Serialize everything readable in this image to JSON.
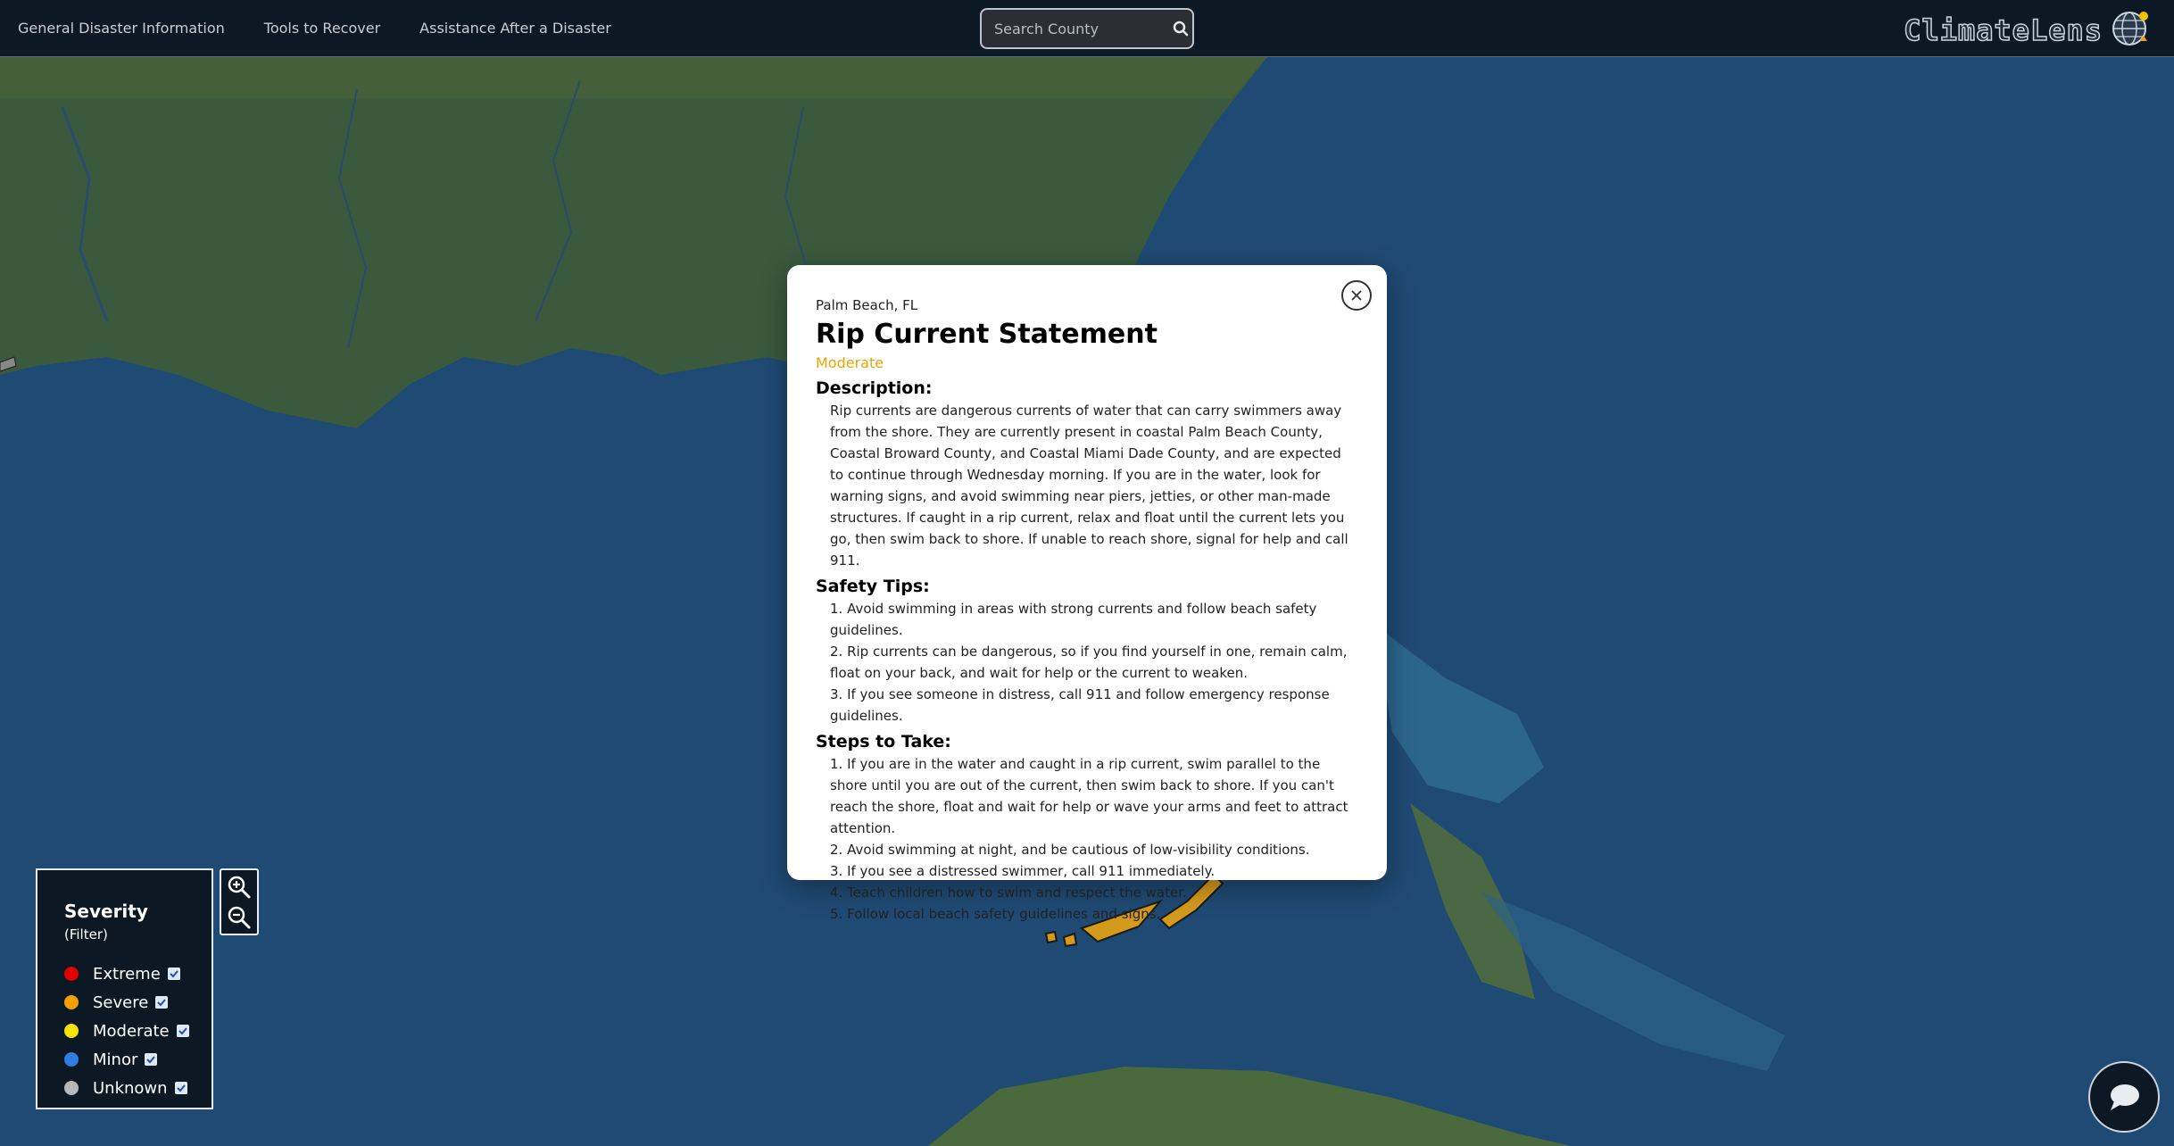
{
  "nav": {
    "links": [
      "General Disaster Information",
      "Tools to Recover",
      "Assistance After a Disaster"
    ]
  },
  "search": {
    "placeholder": "Search County",
    "value": ""
  },
  "brand": {
    "name": "ClimateLens"
  },
  "modal": {
    "location": "Palm Beach, FL",
    "title": "Rip Current Statement",
    "severity": "Moderate",
    "severity_color": "#e8a400",
    "description_label": "Description:",
    "description": "Rip currents are dangerous currents of water that can carry swimmers away from the shore. They are currently present in coastal Palm Beach County, Coastal Broward County, and Coastal Miami Dade County, and are expected to continue through Wednesday morning. If you are in the water, look for warning signs, and avoid swimming near piers, jetties, or other man-made structures. If caught in a rip current, relax and float until the current lets you go, then swim back to shore. If unable to reach shore, signal for help and call 911.",
    "tips_label": "Safety Tips:",
    "tips": [
      "1. Avoid swimming in areas with strong currents and follow beach safety guidelines.",
      "2. Rip currents can be dangerous, so if you find yourself in one, remain calm, float on your back, and wait for help or the current to weaken.",
      "3. If you see someone in distress, call 911 and follow emergency response guidelines."
    ],
    "steps_label": "Steps to Take:",
    "steps": [
      "1. If you are in the water and caught in a rip current, swim parallel to the shore until you are out of the current, then swim back to shore. If you can't reach the shore, float and wait for help or wave your arms and feet to attract attention.",
      "2. Avoid swimming at night, and be cautious of low-visibility conditions.",
      "3. If you see a distressed swimmer, call 911 immediately.",
      "4. Teach children how to swim and respect the water.",
      "5. Follow local beach safety guidelines and signs."
    ]
  },
  "legend": {
    "title": "Severity",
    "subtitle": "(Filter)",
    "items": [
      {
        "label": "Extreme",
        "color": "#e00000",
        "checked": true
      },
      {
        "label": "Severe",
        "color": "#f5a000",
        "checked": true
      },
      {
        "label": "Moderate",
        "color": "#f6e400",
        "checked": true
      },
      {
        "label": "Minor",
        "color": "#2f7de1",
        "checked": true
      },
      {
        "label": "Unknown",
        "color": "#b8b8b8",
        "checked": true
      }
    ]
  },
  "icons": {
    "search": "search-icon",
    "close": "close-icon",
    "zoom_in": "zoom-in-icon",
    "zoom_out": "zoom-out-icon",
    "chat": "chat-icon",
    "globe": "globe-icon"
  },
  "colors": {
    "navbar": "#0d1825",
    "alert_shape": "#d49a1c"
  }
}
